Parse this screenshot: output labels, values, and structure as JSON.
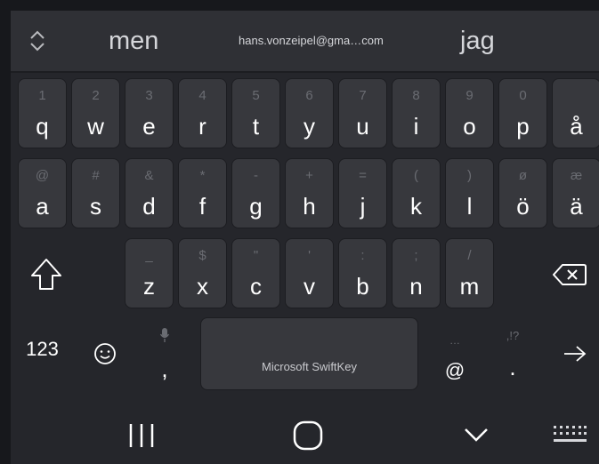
{
  "suggestions": [
    "men",
    "hans.vonzeipel@gma…com",
    "jag"
  ],
  "rows": [
    {
      "keys": [
        {
          "main": "q",
          "hint": "1"
        },
        {
          "main": "w",
          "hint": "2"
        },
        {
          "main": "e",
          "hint": "3"
        },
        {
          "main": "r",
          "hint": "4"
        },
        {
          "main": "t",
          "hint": "5"
        },
        {
          "main": "y",
          "hint": "6"
        },
        {
          "main": "u",
          "hint": "7"
        },
        {
          "main": "i",
          "hint": "8"
        },
        {
          "main": "o",
          "hint": "9"
        },
        {
          "main": "p",
          "hint": "0"
        },
        {
          "main": "å",
          "hint": ""
        }
      ]
    },
    {
      "keys": [
        {
          "main": "a",
          "hint": "@"
        },
        {
          "main": "s",
          "hint": "#"
        },
        {
          "main": "d",
          "hint": "&"
        },
        {
          "main": "f",
          "hint": "*"
        },
        {
          "main": "g",
          "hint": "-"
        },
        {
          "main": "h",
          "hint": "+"
        },
        {
          "main": "j",
          "hint": "="
        },
        {
          "main": "k",
          "hint": "("
        },
        {
          "main": "l",
          "hint": ")"
        },
        {
          "main": "ö",
          "hint": "ø"
        },
        {
          "main": "ä",
          "hint": "æ"
        }
      ]
    },
    {
      "keys": [
        {
          "main": "z",
          "hint": "_"
        },
        {
          "main": "x",
          "hint": "$"
        },
        {
          "main": "c",
          "hint": "\""
        },
        {
          "main": "v",
          "hint": "'"
        },
        {
          "main": "b",
          "hint": ":"
        },
        {
          "main": "n",
          "hint": ";"
        },
        {
          "main": "m",
          "hint": "/"
        }
      ]
    }
  ],
  "bottom_row": {
    "numbers_label": "123",
    "comma": ",",
    "space_label": "Microsoft SwiftKey",
    "at": "@",
    "at_hint": "…",
    "period": ".",
    "period_hint": ",!?"
  },
  "icons": {
    "suggestion_toggle": "chevrons-up-down-icon",
    "shift": "shift-icon",
    "backspace": "backspace-icon",
    "emoji": "emoji-icon",
    "mic": "mic-icon",
    "enter": "arrow-right-icon",
    "recents": "recents-icon",
    "home": "home-icon",
    "hide_keyboard": "chevron-down-icon",
    "keyboard": "keyboard-icon"
  },
  "colors": {
    "background": "#25262b",
    "key": "#37383d",
    "suggestion_bar": "#2f3035",
    "hint_text": "#6a6c72"
  }
}
